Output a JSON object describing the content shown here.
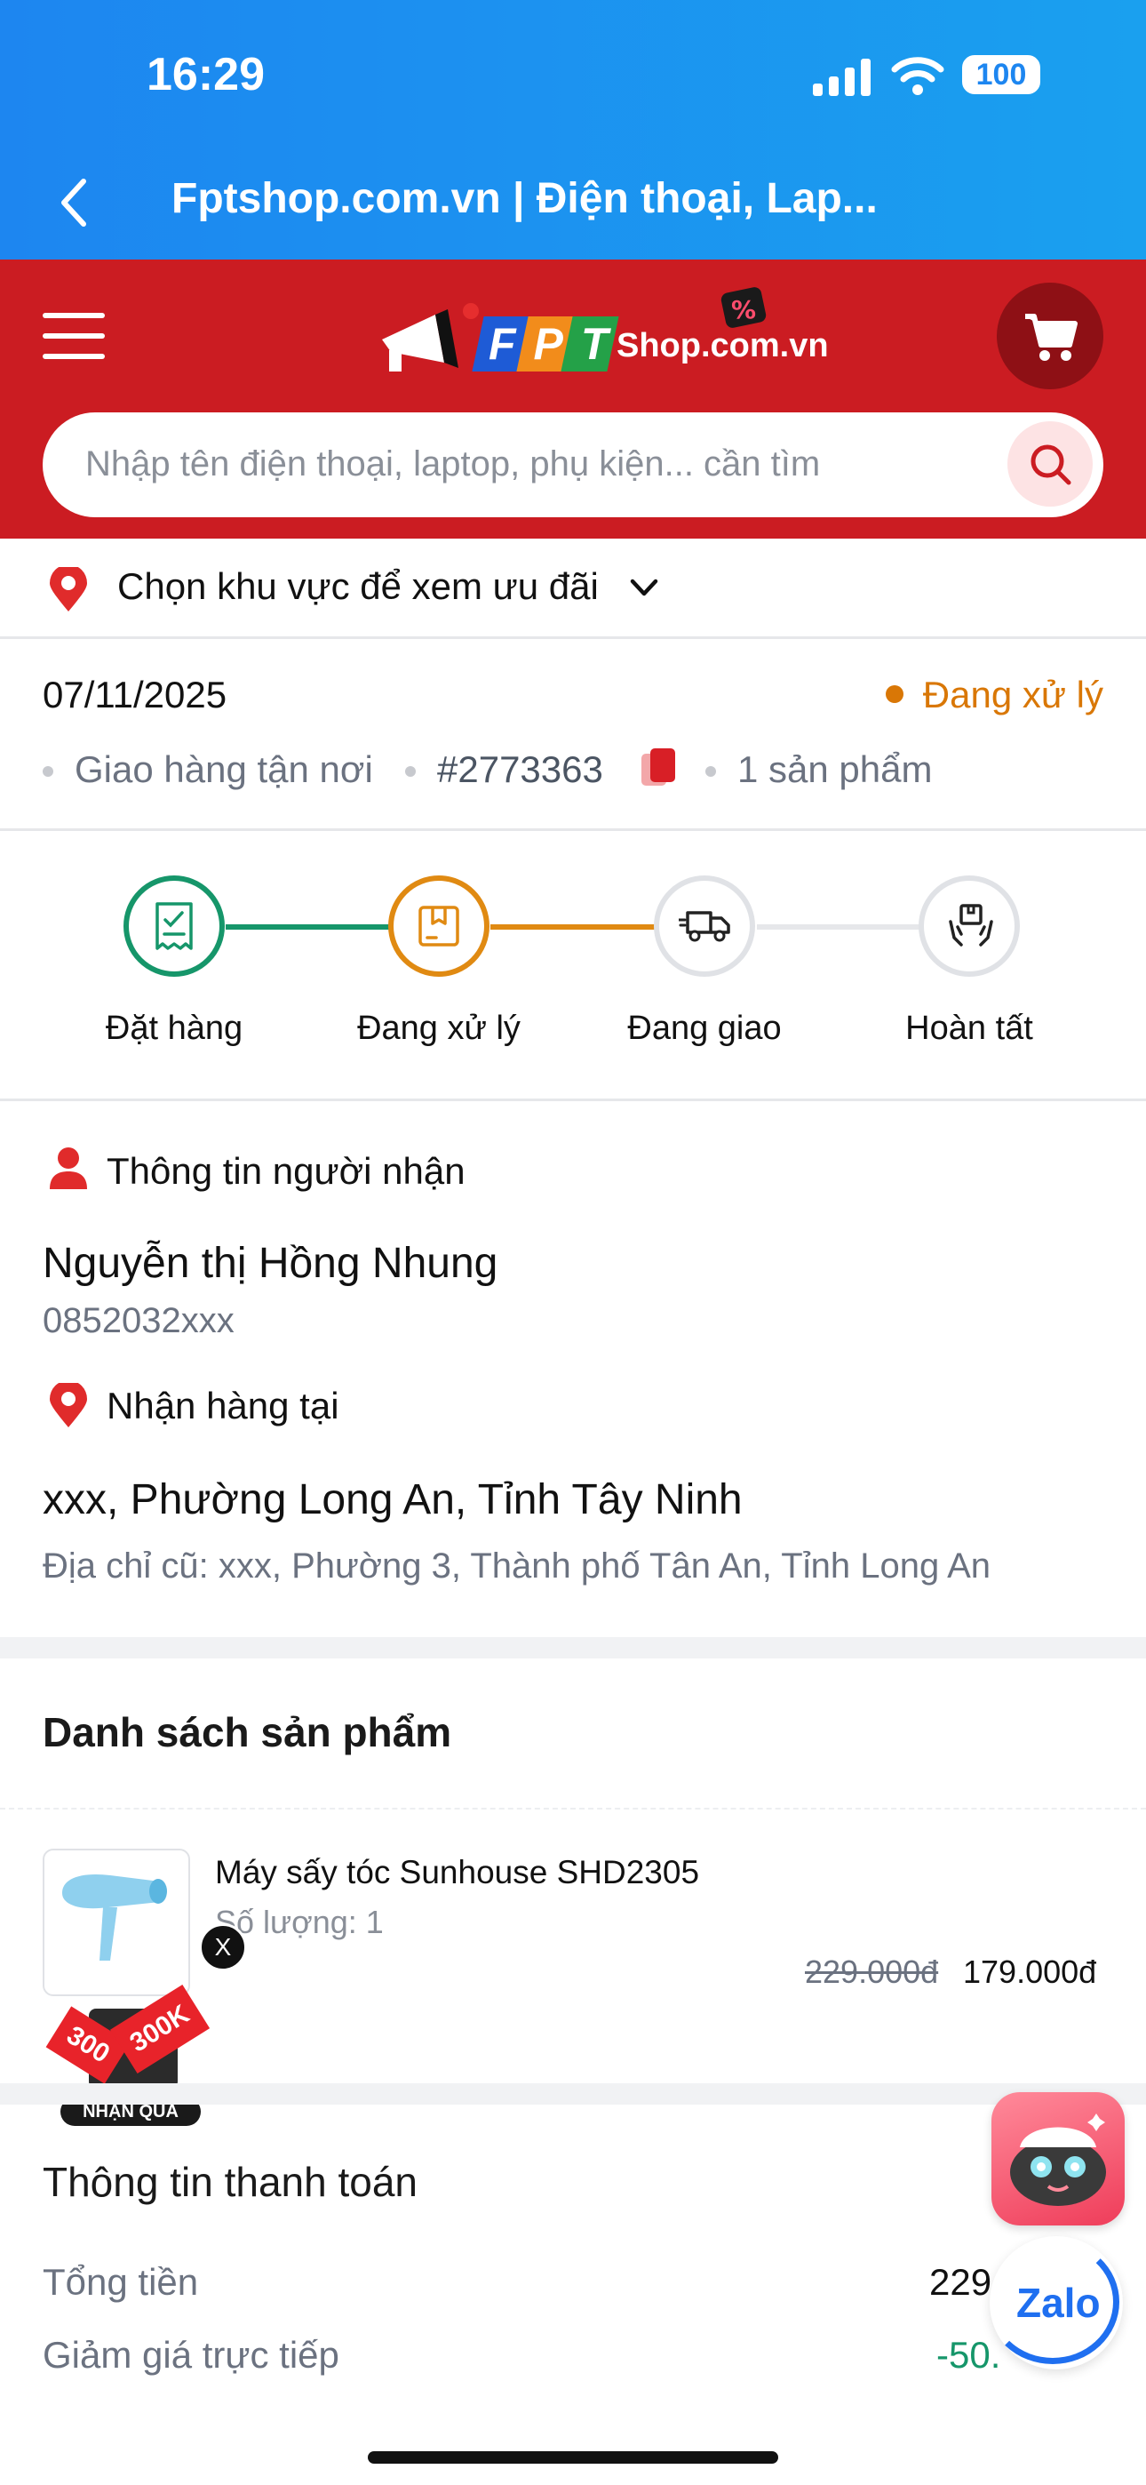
{
  "status_bar": {
    "time": "16:29",
    "battery": "100"
  },
  "browser": {
    "title": "Fptshop.com.vn | Điện thoại, Lap..."
  },
  "header": {
    "logo_text": "FPT",
    "logo_suffix": "Shop.com.vn",
    "search_placeholder": "Nhập tên điện thoại, laptop, phụ kiện... cần tìm",
    "brand_color": "#cb1c22"
  },
  "region": {
    "label": "Chọn khu vực để xem ưu đãi"
  },
  "order": {
    "date": "07/11/2025",
    "status": "Đang xử lý",
    "delivery_type": "Giao hàng tận nơi",
    "order_id": "#2773363",
    "item_count": "1 sản phẩm"
  },
  "steps": [
    {
      "label": "Đặt hàng",
      "state": "done",
      "icon": "receipt-icon"
    },
    {
      "label": "Đang xử lý",
      "state": "current",
      "icon": "box-icon"
    },
    {
      "label": "Đang giao",
      "state": "pending",
      "icon": "truck-icon"
    },
    {
      "label": "Hoàn tất",
      "state": "pending",
      "icon": "hands-box-icon"
    }
  ],
  "recipient": {
    "section_title": "Thông tin người nhận",
    "name": "Nguyễn thị Hồng Nhung",
    "phone": "0852032xxx",
    "pickup_title": "Nhận hàng tại",
    "address": "xxx, Phường Long An, Tỉnh Tây Ninh",
    "old_address": "Địa chỉ cũ: xxx, Phường 3, Thành phố Tân An, Tỉnh Long An"
  },
  "products": {
    "section_title": "Danh sách sản phẩm",
    "items": [
      {
        "name": "Máy sấy tóc Sunhouse SHD2305",
        "quantity": "Số lượng: 1",
        "old_price": "229.000đ",
        "price": "179.000đ"
      }
    ]
  },
  "promo": {
    "badge": "NHẬN QUÀ",
    "close": "X",
    "tag1": "300",
    "tag2": "300K"
  },
  "payment": {
    "section_title": "Thông tin thanh toán",
    "total_label": "Tổng tiền",
    "total_value": "229",
    "discount_label": "Giảm giá trực tiếp",
    "discount_value": "-50."
  },
  "zalo": {
    "label": "Zalo"
  },
  "colors": {
    "processing": "#d97706",
    "done": "#16966a",
    "pending": "#d9dbe0"
  }
}
